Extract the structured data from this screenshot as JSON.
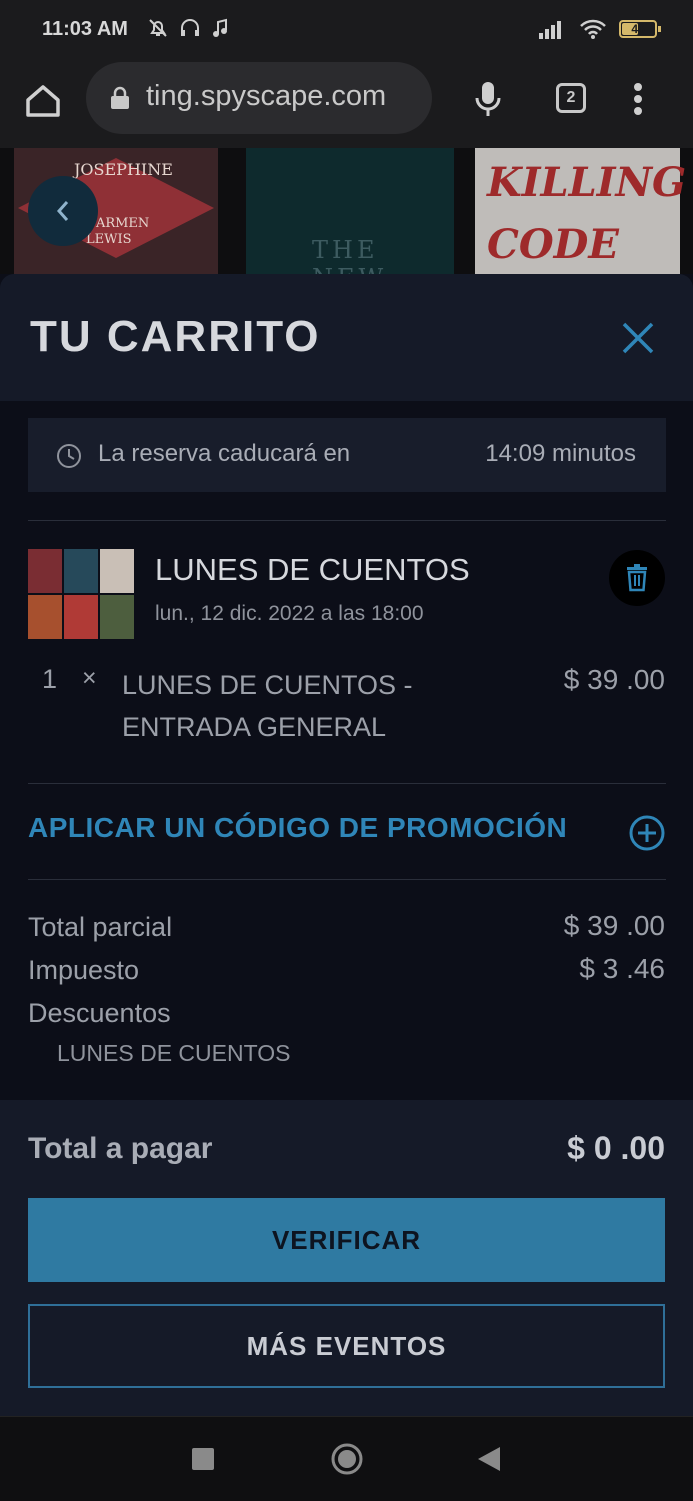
{
  "status_bar": {
    "time": "11:03 AM",
    "battery": "46",
    "battery_level": 0.46
  },
  "browser": {
    "url": "ting.spyscape.com",
    "tab_count": "2"
  },
  "thumbnails": {
    "book1_title": "JOSEPHINE",
    "book1_author": "CARMEN LEWIS",
    "book2_title": "THE NEW",
    "book3_title": "KILLING CODE"
  },
  "cart": {
    "title": "TU CARRITO",
    "reservation_label": "La reserva caducará en",
    "reservation_time": "14:09 minutos",
    "event": {
      "name": "LUNES DE CUENTOS",
      "date": "lun., 12 dic. 2022 a las 18:00",
      "quantity": "1",
      "times": "×",
      "ticket_name": "LUNES DE CUENTOS - ENTRADA GENERAL",
      "price": "$ 39 .00"
    },
    "promo_label": "APLICAR UN CÓDIGO DE PROMOCIÓN",
    "summary": {
      "subtotal_label": "Total parcial",
      "subtotal_value": "$ 39 .00",
      "tax_label": "Impuesto",
      "tax_value": "$ 3 .46",
      "discounts_label": "Descuentos",
      "discount_item": "LUNES DE CUENTOS"
    },
    "total_label": "Total a pagar",
    "total_value": "$ 0 .00",
    "verify_button": "VERIFICAR",
    "more_events_button": "MÁS EVENTOS"
  },
  "colors": {
    "accent": "#2f86b8",
    "button": "#2f7aa2",
    "sheet_bg": "#0c0e18",
    "header_bg": "#151a28"
  }
}
